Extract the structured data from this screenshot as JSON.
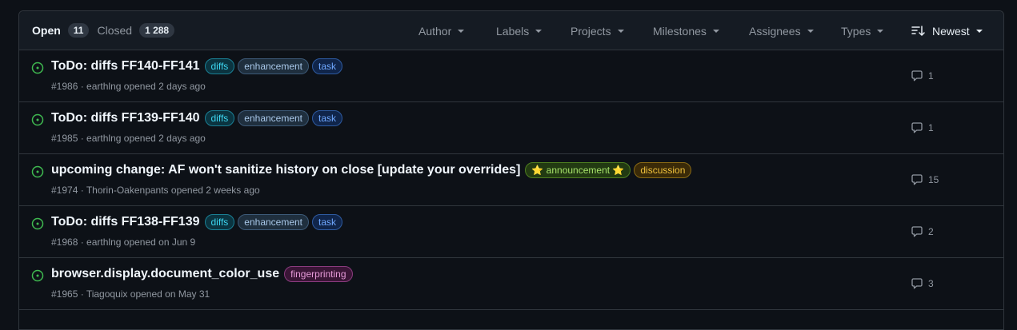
{
  "header": {
    "open_label": "Open",
    "open_count": "11",
    "closed_label": "Closed",
    "closed_count": "1 288",
    "filters": [
      "Author",
      "Labels",
      "Projects",
      "Milestones",
      "Assignees",
      "Types"
    ],
    "sort_label": "Newest"
  },
  "colors": {
    "open_icon": "#3fb950",
    "border": "#30363d",
    "background": "#0d1117",
    "header_bg": "#151b23"
  },
  "issues": [
    {
      "title": "ToDo: diffs FF140-FF141",
      "number": "#1986",
      "author": "earthlng",
      "opened": "opened 2 days ago",
      "comments": "1",
      "labels": [
        {
          "name": "diffs",
          "fg": "#3dd6f0",
          "bg": "#0b3440",
          "border": "#1a7f94"
        },
        {
          "name": "enhancement",
          "fg": "#a8c7e8",
          "bg": "#1f2f3e",
          "border": "#3d5a78"
        },
        {
          "name": "task",
          "fg": "#6fa8ff",
          "bg": "#10254a",
          "border": "#2d5aa0"
        }
      ]
    },
    {
      "title": "ToDo: diffs FF139-FF140",
      "number": "#1985",
      "author": "earthlng",
      "opened": "opened 2 days ago",
      "comments": "1",
      "labels": [
        {
          "name": "diffs",
          "fg": "#3dd6f0",
          "bg": "#0b3440",
          "border": "#1a7f94"
        },
        {
          "name": "enhancement",
          "fg": "#a8c7e8",
          "bg": "#1f2f3e",
          "border": "#3d5a78"
        },
        {
          "name": "task",
          "fg": "#6fa8ff",
          "bg": "#10254a",
          "border": "#2d5aa0"
        }
      ]
    },
    {
      "title": "upcoming change: AF won't sanitize history on close [update your overrides]",
      "number": "#1974",
      "author": "Thorin-Oakenpants",
      "opened": "opened 2 weeks ago",
      "comments": "15",
      "labels": [
        {
          "name": "⭐ announcement ⭐",
          "fg": "#a6e36a",
          "bg": "#223a12",
          "border": "#4e7f20"
        },
        {
          "name": "discussion",
          "fg": "#f0c23d",
          "bg": "#3a2a08",
          "border": "#8a6a14"
        }
      ]
    },
    {
      "title": "ToDo: diffs FF138-FF139",
      "number": "#1968",
      "author": "earthlng",
      "opened": "opened on Jun 9",
      "comments": "2",
      "labels": [
        {
          "name": "diffs",
          "fg": "#3dd6f0",
          "bg": "#0b3440",
          "border": "#1a7f94"
        },
        {
          "name": "enhancement",
          "fg": "#a8c7e8",
          "bg": "#1f2f3e",
          "border": "#3d5a78"
        },
        {
          "name": "task",
          "fg": "#6fa8ff",
          "bg": "#10254a",
          "border": "#2d5aa0"
        }
      ]
    },
    {
      "title": "browser.display.document_color_use",
      "number": "#1965",
      "author": "Tiagoquix",
      "opened": "opened on May 31",
      "comments": "3",
      "labels": [
        {
          "name": "fingerprinting",
          "fg": "#e69ad8",
          "bg": "#3a1536",
          "border": "#8a3b7e"
        }
      ]
    }
  ]
}
